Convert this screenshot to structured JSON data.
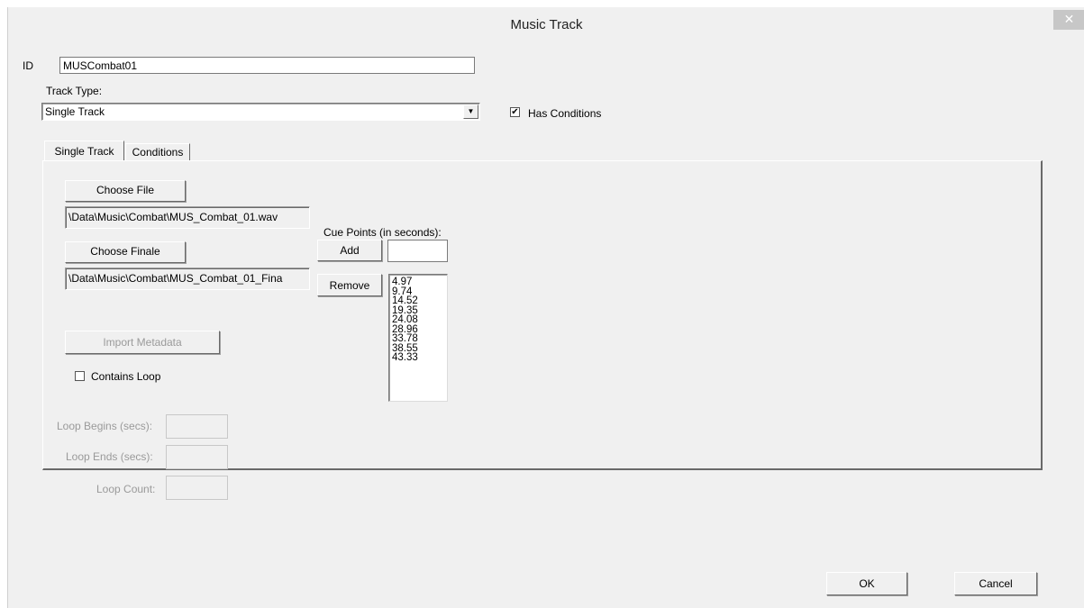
{
  "window": {
    "title": "Music Track",
    "close_glyph": "✕"
  },
  "id_field": {
    "label": "ID",
    "value": "MUSCombat01"
  },
  "track_type": {
    "label": "Track Type:",
    "selected": "Single Track"
  },
  "has_conditions": {
    "label": "Has Conditions",
    "checked": true
  },
  "tabs": [
    {
      "label": "Single Track",
      "active": true
    },
    {
      "label": "Conditions",
      "active": false
    }
  ],
  "single_track": {
    "choose_file_label": "Choose File",
    "file_path": "\\Data\\Music\\Combat\\MUS_Combat_01.wav",
    "choose_finale_label": "Choose Finale",
    "finale_path": "\\Data\\Music\\Combat\\MUS_Combat_01_Fina",
    "import_metadata_label": "Import Metadata",
    "contains_loop_label": "Contains Loop",
    "contains_loop_checked": false,
    "loop_begins_label": "Loop Begins (secs):",
    "loop_ends_label": "Loop Ends (secs):",
    "loop_count_label": "Loop Count:"
  },
  "cue_points": {
    "label": "Cue Points (in seconds):",
    "add_label": "Add",
    "remove_label": "Remove",
    "input_value": "",
    "values": [
      "4.97",
      "9.74",
      "14.52",
      "19.35",
      "24.08",
      "28.96",
      "33.78",
      "38.55",
      "43.33"
    ]
  },
  "footer": {
    "ok_label": "OK",
    "cancel_label": "Cancel"
  },
  "icons": {
    "close": "close-icon",
    "dropdown": "chevron-down-icon",
    "checkmark": "checkmark-icon"
  }
}
